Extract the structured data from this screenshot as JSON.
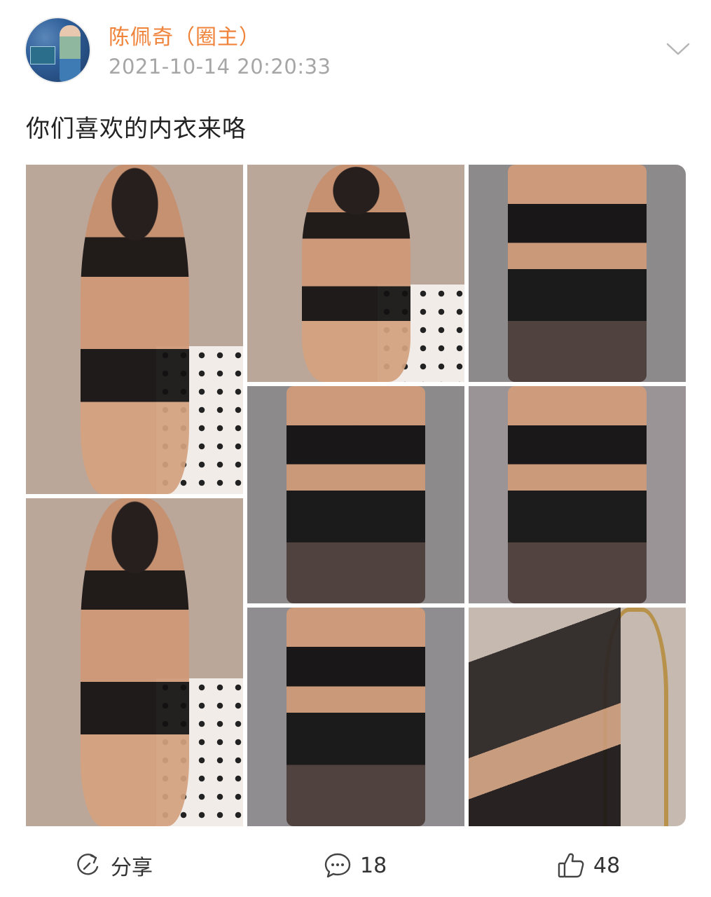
{
  "post": {
    "username": "陈佩奇（圈主）",
    "timestamp": "2021-10-14 20:20:33",
    "text": "你们喜欢的内衣来咯"
  },
  "gallery": {
    "image_count": 8,
    "images": [
      {
        "icon": "photo-1"
      },
      {
        "icon": "photo-2"
      },
      {
        "icon": "photo-3"
      },
      {
        "icon": "photo-4"
      },
      {
        "icon": "photo-5"
      },
      {
        "icon": "photo-6"
      },
      {
        "icon": "photo-7"
      },
      {
        "icon": "photo-8"
      }
    ]
  },
  "actions": {
    "share_label": "分享",
    "comment_count": "18",
    "like_count": "48"
  },
  "colors": {
    "username": "#f0833a",
    "timestamp": "#a6a6a6",
    "text": "#222222",
    "icon": "#444444"
  }
}
